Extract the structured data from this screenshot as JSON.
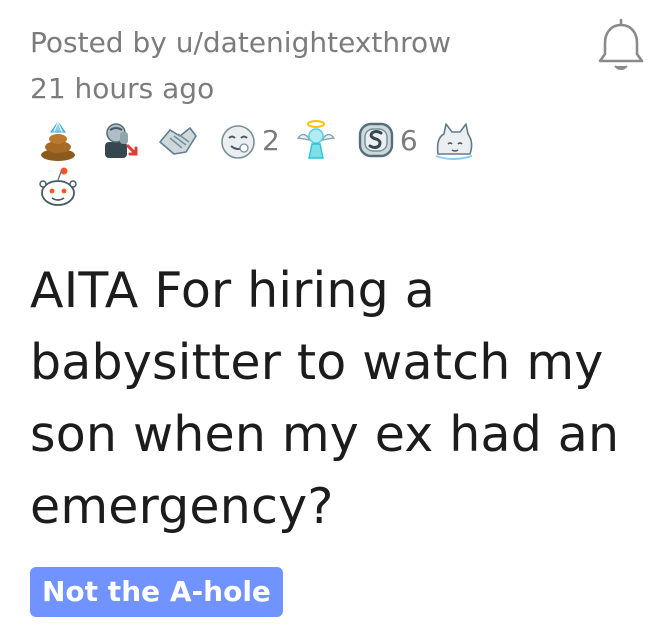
{
  "post": {
    "posted_by": "Posted by u/datenightexthrow",
    "time_ago": "21 hours ago",
    "title": "AITA For hiring a babysitter to watch my son when my ex had an emergency?",
    "flair": "Not the A-hole"
  },
  "awards": [
    {
      "name": "poop-award",
      "count": ""
    },
    {
      "name": "facepalm-award",
      "count": ""
    },
    {
      "name": "handshake-award",
      "count": ""
    },
    {
      "name": "wholesome-award",
      "count": "2"
    },
    {
      "name": "angel-award",
      "count": ""
    },
    {
      "name": "silver-award",
      "count": "6"
    },
    {
      "name": "cat-award",
      "count": ""
    },
    {
      "name": "snoo-award",
      "count": ""
    }
  ],
  "icons": {
    "follow": "bell-icon"
  },
  "colors": {
    "meta_text": "#7c7c7c",
    "title_text": "#1c1c1c",
    "flair_bg": "#7193ff",
    "flair_text": "#ffffff"
  }
}
